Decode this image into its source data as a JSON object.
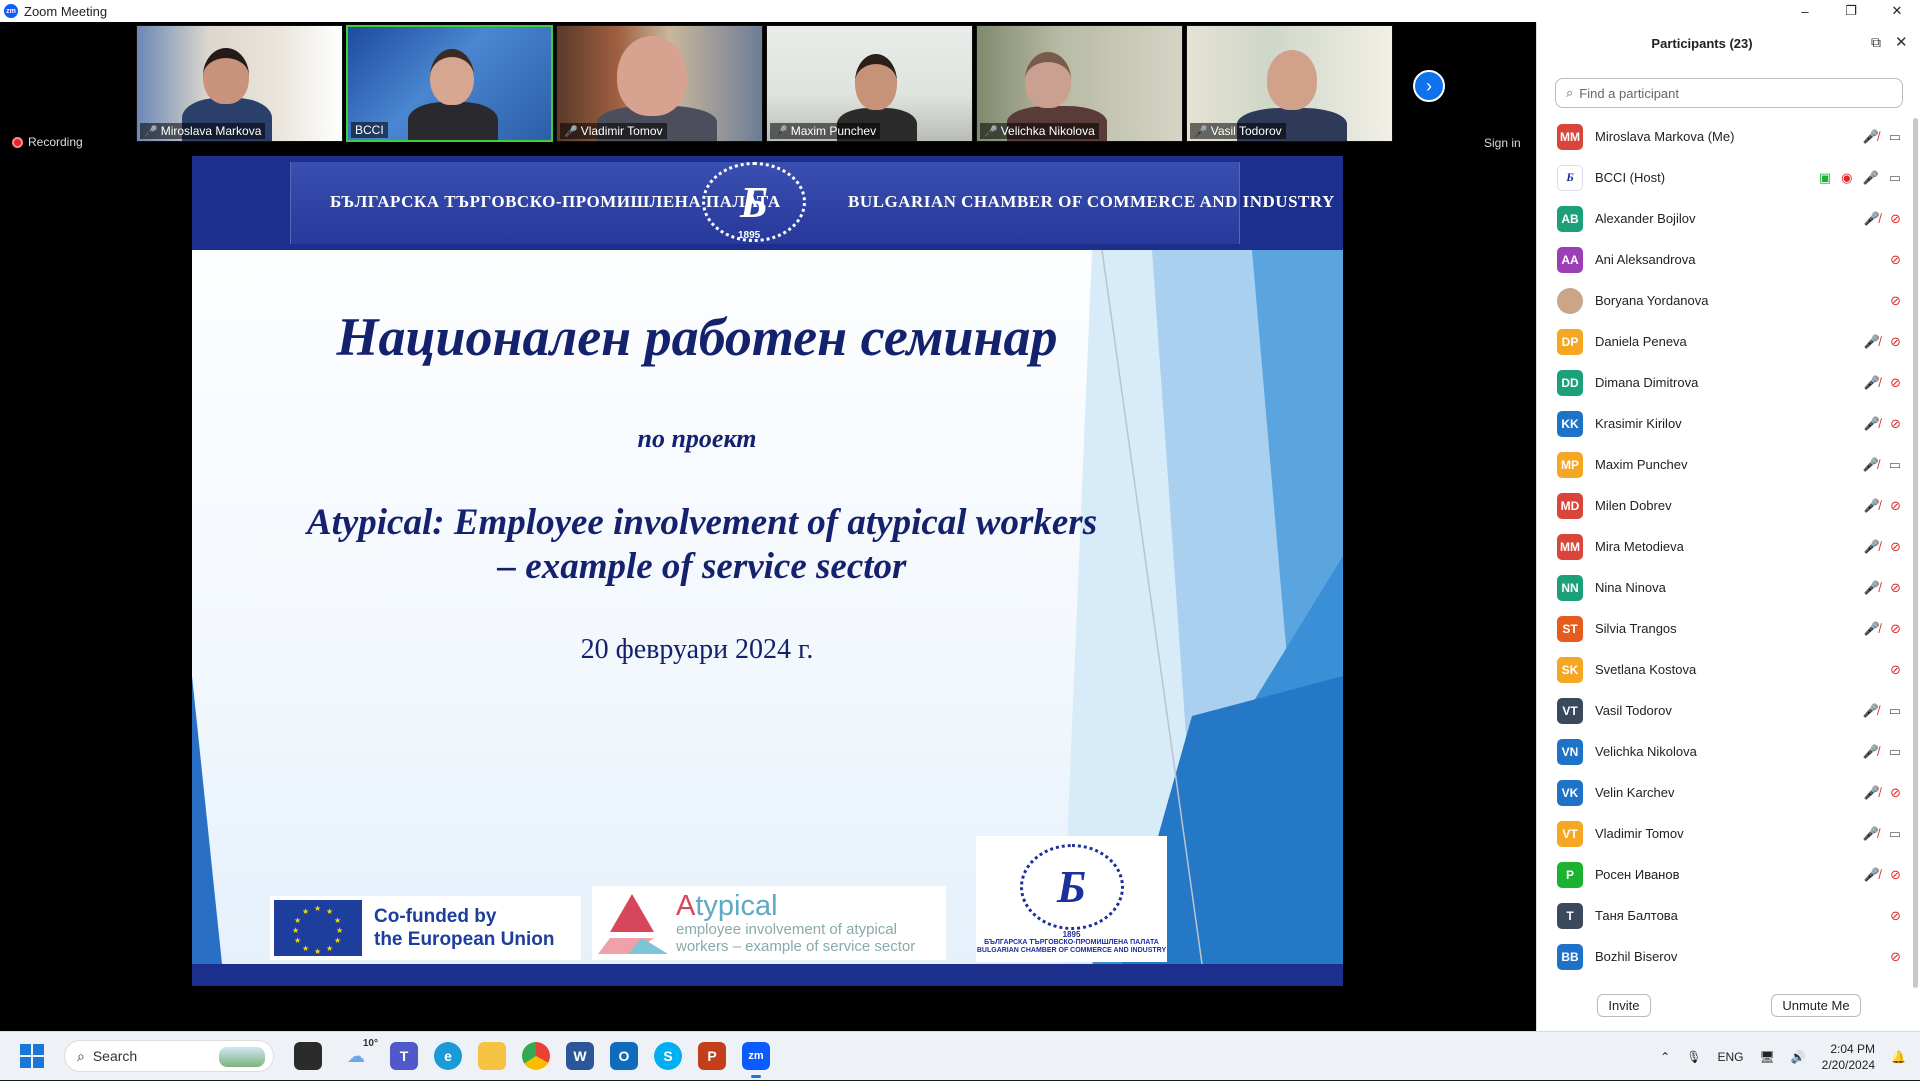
{
  "window": {
    "title": "Zoom Meeting",
    "minimize": "–",
    "maximize": "❐",
    "close": "✕"
  },
  "thumbnails": [
    {
      "name": "Miroslava Markova",
      "muted": true
    },
    {
      "name": "BCCI",
      "muted": false,
      "active": true
    },
    {
      "name": "Vladimir Tomov",
      "muted": true
    },
    {
      "name": "Maxim Punchev",
      "muted": true
    },
    {
      "name": "Velichka Nikolova",
      "muted": true
    },
    {
      "name": "Vasil Todorov",
      "muted": true
    }
  ],
  "stage": {
    "recording_label": "Recording",
    "sign_in": "Sign in"
  },
  "slide": {
    "header_left": "БЪЛГАРСКА ТЪРГОВСКО-ПРОМИШЛЕНА ПАЛАТА",
    "header_right": "BULGARIAN CHAMBER OF COMMERCE AND INDUSTRY",
    "header_year": "1895",
    "title": "Национален работен семинар",
    "subtitle": "по проект",
    "project_line1": "Atypical: Employee involvement of atypical workers",
    "project_line2": "– example of service sector",
    "date": "20 февруари 2024 г.",
    "eu_line1": "Co-funded by",
    "eu_line2": "the European Union",
    "atypical_a": "A",
    "atypical_rest": "typical",
    "atypical_tag1": "employee involvement of atypical",
    "atypical_tag2": "workers – example of service sector",
    "bcci_year": "1895",
    "bcci_label1": "БЪЛГАРСКА ТЪРГОВСКО-ПРОМИШЛЕНА ПАЛАТА",
    "bcci_label2": "BULGARIAN CHAMBER OF COMMERCE AND INDUSTRY"
  },
  "participants_panel": {
    "title": "Participants (23)",
    "search_placeholder": "Find a participant",
    "invite": "Invite",
    "unmute_me": "Unmute Me",
    "participants": [
      {
        "initials": "MM",
        "name": "Miroslava Markova (Me)",
        "color": "#d9453b",
        "mic": "off",
        "cam": "on"
      },
      {
        "initials": "",
        "name": "BCCI (Host)",
        "color": "#ffffff",
        "mic": "on",
        "cam": "on",
        "sharing": true,
        "recording": true
      },
      {
        "initials": "AB",
        "name": "Alexander Bojilov",
        "color": "#1ba07a",
        "mic": "off",
        "cam": "off"
      },
      {
        "initials": "AA",
        "name": "Ani Aleksandrova",
        "color": "#9c3fb5",
        "mic": "none",
        "cam": "off"
      },
      {
        "initials": "",
        "name": "Boryana Yordanova",
        "color": "#c9a58a",
        "mic": "none",
        "cam": "off"
      },
      {
        "initials": "DP",
        "name": "Daniela Peneva",
        "color": "#f5a623",
        "mic": "off",
        "cam": "off"
      },
      {
        "initials": "DD",
        "name": "Dimana Dimitrova",
        "color": "#1ba07a",
        "mic": "off",
        "cam": "off"
      },
      {
        "initials": "KK",
        "name": "Krasimir Kirilov",
        "color": "#1e73c9",
        "mic": "off",
        "cam": "off"
      },
      {
        "initials": "MP",
        "name": "Maxim Punchev",
        "color": "#f5a623",
        "mic": "off",
        "cam": "on"
      },
      {
        "initials": "MD",
        "name": "Milen Dobrev",
        "color": "#d9453b",
        "mic": "off",
        "cam": "off"
      },
      {
        "initials": "MM",
        "name": "Mira Metodieva",
        "color": "#d9453b",
        "mic": "off",
        "cam": "off"
      },
      {
        "initials": "NN",
        "name": "Nina Ninova",
        "color": "#1ba07a",
        "mic": "off",
        "cam": "off"
      },
      {
        "initials": "ST",
        "name": "Silvia Trangos",
        "color": "#e65c1e",
        "mic": "off",
        "cam": "off"
      },
      {
        "initials": "SK",
        "name": "Svetlana Kostova",
        "color": "#f5a623",
        "mic": "none",
        "cam": "off"
      },
      {
        "initials": "VT",
        "name": "Vasil Todorov",
        "color": "#3a4a5c",
        "mic": "off",
        "cam": "on"
      },
      {
        "initials": "VN",
        "name": "Velichka Nikolova",
        "color": "#1e73c9",
        "mic": "off",
        "cam": "on"
      },
      {
        "initials": "VK",
        "name": "Velin Karchev",
        "color": "#1e73c9",
        "mic": "off",
        "cam": "off"
      },
      {
        "initials": "VT",
        "name": "Vladimir Tomov",
        "color": "#f5a623",
        "mic": "off",
        "cam": "on"
      },
      {
        "initials": "P",
        "name": "Росен Иванов",
        "color": "#1bb232",
        "mic": "off",
        "cam": "off"
      },
      {
        "initials": "T",
        "name": "Таня Балтова",
        "color": "#3a4a5c",
        "mic": "none",
        "cam": "off"
      },
      {
        "initials": "BB",
        "name": "Bozhil Biserov",
        "color": "#1e73c9",
        "mic": "none",
        "cam": "off"
      }
    ]
  },
  "taskbar": {
    "search": "Search",
    "weather": "10°",
    "language": "ENG",
    "time": "2:04 PM",
    "date": "2/20/2024"
  }
}
